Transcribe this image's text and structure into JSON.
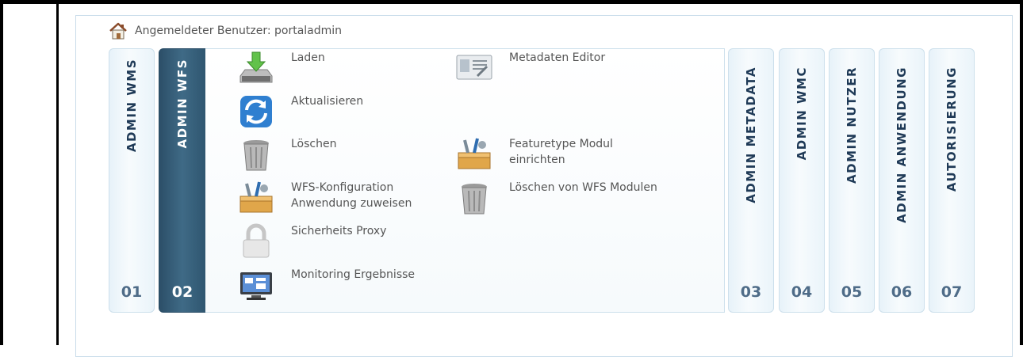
{
  "user": {
    "label": "Angemeldeter Benutzer: portaladmin"
  },
  "tabs": [
    {
      "title": "ADMIN WMS",
      "num": "01",
      "active": false
    },
    {
      "title": "ADMIN WFS",
      "num": "02",
      "active": true
    },
    {
      "title": "ADMIN METADATA",
      "num": "03",
      "active": false
    },
    {
      "title": "ADMIN WMC",
      "num": "04",
      "active": false
    },
    {
      "title": "ADMIN NUTZER",
      "num": "05",
      "active": false
    },
    {
      "title": "ADMIN ANWENDUNG",
      "num": "06",
      "active": false
    },
    {
      "title": "AUTORISIERUNG",
      "num": "07",
      "active": false
    }
  ],
  "wfs_menu": {
    "left": [
      {
        "label": "Laden",
        "icon": "download-icon"
      },
      {
        "label": "Aktualisieren",
        "icon": "refresh-icon"
      },
      {
        "label": "Löschen",
        "icon": "trash-icon"
      },
      {
        "label": "WFS-Konfiguration\nAnwendung zuweisen",
        "icon": "toolbox-icon"
      },
      {
        "label": "Sicherheits Proxy",
        "icon": "lock-icon"
      },
      {
        "label": "Monitoring Ergebnisse",
        "icon": "monitor-icon"
      }
    ],
    "right": [
      {
        "label": "Metadaten Editor",
        "icon": "id-card-icon"
      },
      {
        "label": "Featuretype Modul\neinrichten",
        "icon": "toolbox-icon"
      },
      {
        "label": "Löschen von WFS Modulen",
        "icon": "trash-icon"
      }
    ]
  },
  "colors": {
    "active_tab": "#2c4f68",
    "tab_text": "#1f3a57",
    "tab_number": "#4f6c88",
    "border": "#cde0ec"
  }
}
